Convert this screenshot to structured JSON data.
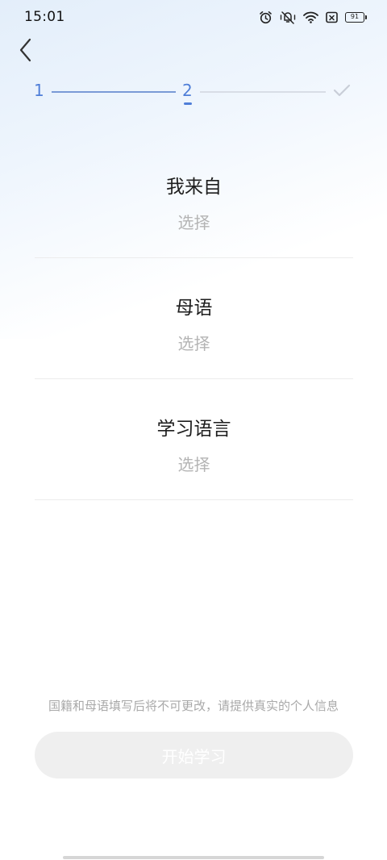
{
  "status_bar": {
    "time": "15:01",
    "battery": "91",
    "icons": [
      "alarm-icon",
      "mute-vibrate-icon",
      "wifi-icon",
      "sim-none-icon",
      "battery-icon"
    ]
  },
  "nav": {
    "back_icon": "chevron-left-icon"
  },
  "stepper": {
    "steps": [
      "1",
      "2"
    ],
    "current_step": 2,
    "final_icon": "check-icon",
    "active_color": "#4f7ed8"
  },
  "fields": [
    {
      "label": "我来自",
      "value": "选择"
    },
    {
      "label": "母语",
      "value": "选择"
    },
    {
      "label": "学习语言",
      "value": "选择"
    }
  ],
  "notice": "国籍和母语填写后将不可更改，请提供真实的个人信息",
  "start_button": {
    "label": "开始学习",
    "enabled": false
  }
}
